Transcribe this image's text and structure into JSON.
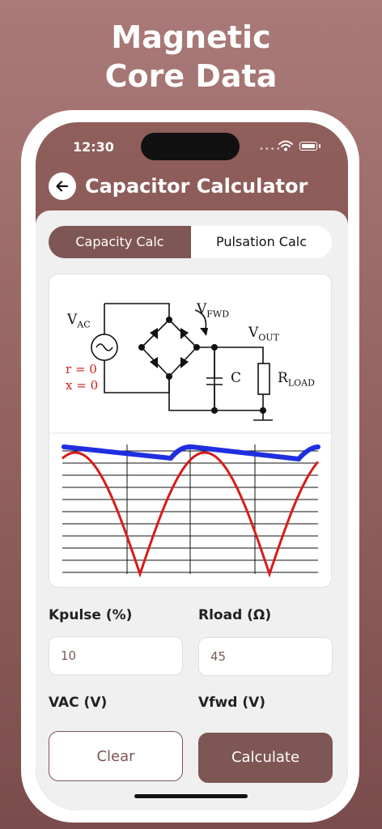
{
  "promo": {
    "line1": "Magnetic",
    "line2": "Core Data"
  },
  "status_bar": {
    "time": "12:30"
  },
  "header": {
    "title": "Capacitor Calculator"
  },
  "tabs": [
    {
      "label": "Capacity Calc",
      "active": true
    },
    {
      "label": "Pulsation Calc",
      "active": false
    }
  ],
  "diagram": {
    "vac": "V",
    "vac_sub": "AC",
    "vfwd": "V",
    "vfwd_sub": "FWD",
    "vout": "V",
    "vout_sub": "OUT",
    "r_note": "r = 0",
    "x_note": "x = 0",
    "cap": "C",
    "rload": "R",
    "rload_sub": "LOAD"
  },
  "form": {
    "kpulse_label": "Kpulse (%)",
    "kpulse_value": "10",
    "rload_label": "Rload (Ω)",
    "rload_value": "45",
    "vac_label": "VAC (V)",
    "vfwd_label": "Vfwd (V)"
  },
  "actions": {
    "clear": "Clear",
    "calculate": "Calculate"
  },
  "colors": {
    "accent": "#7e5654",
    "ripple": "#1f2fe0",
    "rectified": "#d81b1b"
  }
}
